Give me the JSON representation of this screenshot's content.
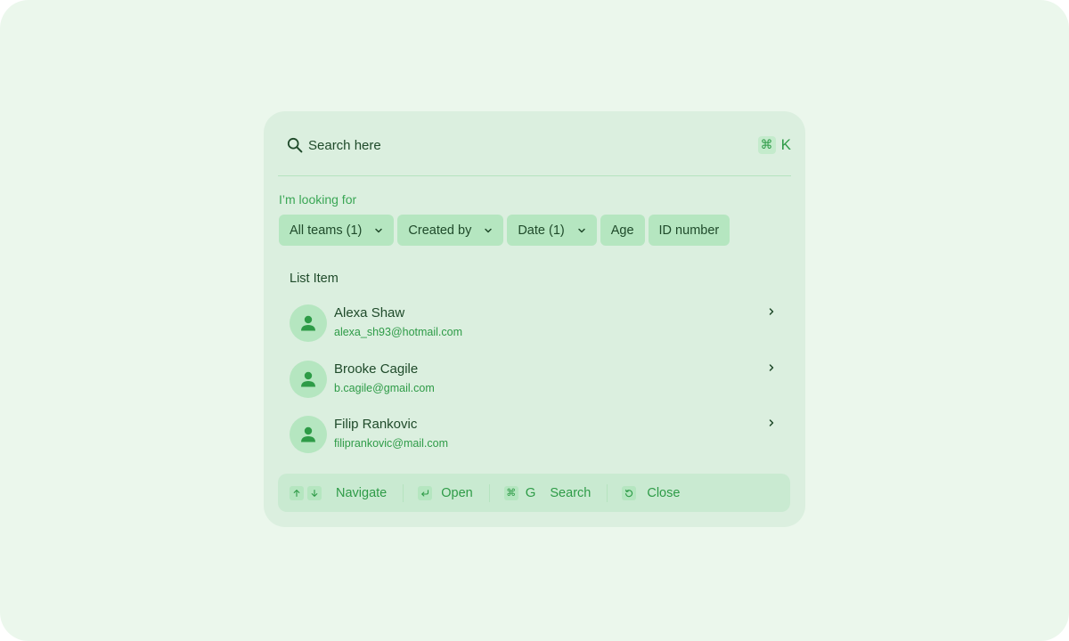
{
  "search": {
    "placeholder": "Search here"
  },
  "shortcut": {
    "modifier": "⌘",
    "key": "K"
  },
  "filters": {
    "label": "I’m looking for",
    "chips": [
      {
        "label": "All teams (1)",
        "dropdown": true
      },
      {
        "label": "Created by",
        "dropdown": true
      },
      {
        "label": "Date (1)",
        "dropdown": true
      },
      {
        "label": "Age",
        "dropdown": false
      },
      {
        "label": "ID number",
        "dropdown": false
      }
    ]
  },
  "list": {
    "title": "List Item",
    "items": [
      {
        "name": "Alexa Shaw",
        "email": "alexa_sh93@hotmail.com",
        "icon": "user-icon"
      },
      {
        "name": "Brooke Cagile",
        "email": "b.cagile@gmail.com",
        "icon": "user-icon"
      },
      {
        "name": "Filip Rankovic",
        "email": "filiprankovic@mail.com",
        "icon": "user-icon"
      }
    ]
  },
  "footer": {
    "navigate": "Navigate",
    "open": "Open",
    "search_modifier": "⌘",
    "search_key": "G",
    "search": "Search",
    "close": "Close"
  },
  "colors": {
    "background": "#ebf7ec",
    "panel": "#dbefdf",
    "chip": "#b5e6c0",
    "accent": "#2e9b47",
    "text": "#1f4a2a"
  }
}
